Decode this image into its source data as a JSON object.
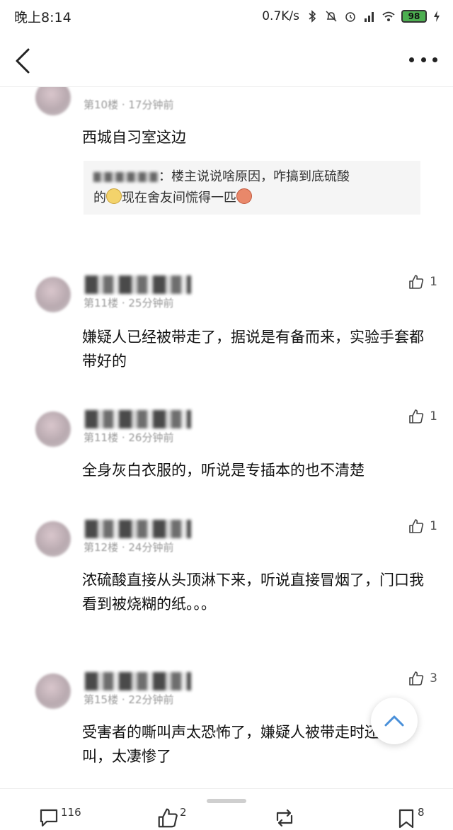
{
  "status_bar": {
    "time": "晚上8:14",
    "speed": "0.7K/s",
    "battery": "98"
  },
  "comments": [
    {
      "meta": "第10楼 · 17分钟前",
      "text": "西城自习室这边",
      "quote": {
        "text1": "：楼主说说啥原因，咋搞到底硫酸",
        "text2_a": "的",
        "text2_b": "现在舍友间慌得一匹"
      }
    },
    {
      "meta": "第11楼 · 25分钟前",
      "likes": "1",
      "text": "嫌疑人已经被带走了，据说是有备而来，实验手套都带好的"
    },
    {
      "meta": "第11楼 · 26分钟前",
      "likes": "1",
      "text": "全身灰白衣服的，听说是专插本的也不清楚"
    },
    {
      "meta": "第12楼 · 24分钟前",
      "likes": "1",
      "text": "浓硫酸直接从头顶淋下来，听说直接冒烟了，门口我看到被烧糊的纸。。。"
    },
    {
      "meta": "第15楼 · 22分钟前",
      "likes": "3",
      "text": "受害者的嘶叫声太恐怖了，嫌疑人被带走时还在嘶叫，太凄惨了"
    }
  ],
  "bottom_bar": {
    "comments": "116",
    "likes": "2",
    "forward": "",
    "favorites": "8"
  },
  "icons": {
    "back": "back-arrow-icon",
    "more": "more-dots-icon",
    "like": "thumb-up-icon",
    "scroll_top": "chevron-up-icon"
  },
  "colors": {
    "accent": "#4a90d9",
    "text": "#111111",
    "muted": "#9a9a9a"
  }
}
